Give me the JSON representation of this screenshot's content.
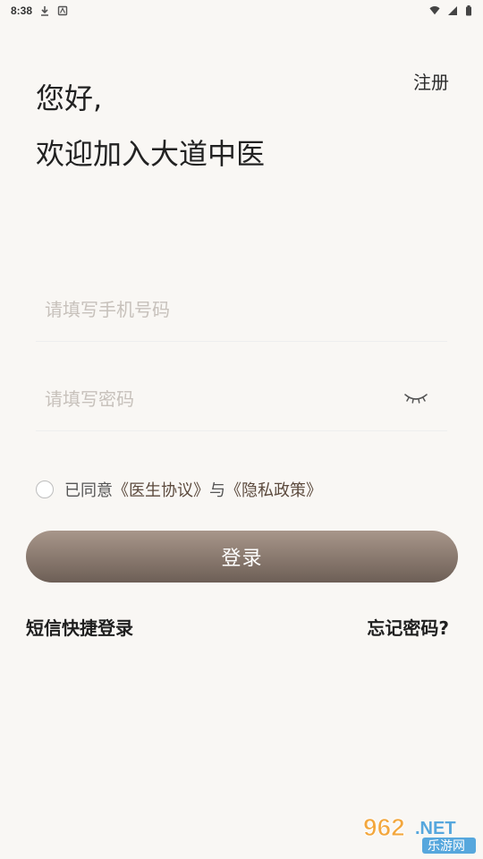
{
  "status_bar": {
    "time": "8:38"
  },
  "header": {
    "register_label": "注册",
    "greeting": "您好,",
    "welcome": "欢迎加入大道中医"
  },
  "form": {
    "phone_placeholder": "请填写手机号码",
    "phone_value": "",
    "password_placeholder": "请填写密码",
    "password_value": ""
  },
  "agreement": {
    "prefix": "已同意",
    "doctor_agreement": "《医生协议》",
    "and": "与",
    "privacy_policy": "《隐私政策》",
    "checked": false
  },
  "actions": {
    "login_label": "登录",
    "sms_login_label": "短信快捷登录",
    "forgot_password_label": "忘记密码?"
  },
  "watermark": {
    "brand": "962",
    "suffix": ".NET",
    "site_name": "乐游网"
  },
  "colors": {
    "background": "#f9f7f4",
    "button_top": "#a8968a",
    "button_bottom": "#6d5f56"
  }
}
